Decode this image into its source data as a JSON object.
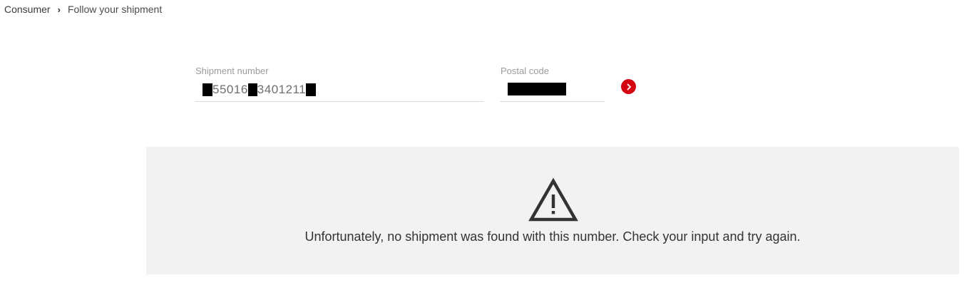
{
  "breadcrumb": {
    "items": [
      "Consumer",
      "Follow your shipment"
    ],
    "separator": "›"
  },
  "form": {
    "shipment_number": {
      "label": "Shipment number",
      "value_parts": [
        "55016",
        "3401211"
      ]
    },
    "postal_code": {
      "label": "Postal code"
    },
    "submit_icon": "chevron-right-icon"
  },
  "result": {
    "icon": "warning-icon",
    "message": "Unfortunately, no shipment was found with this number. Check your input and try again."
  },
  "colors": {
    "accent": "#d40511",
    "panel_background": "#f2f2f2",
    "label": "#9b9b9b"
  }
}
